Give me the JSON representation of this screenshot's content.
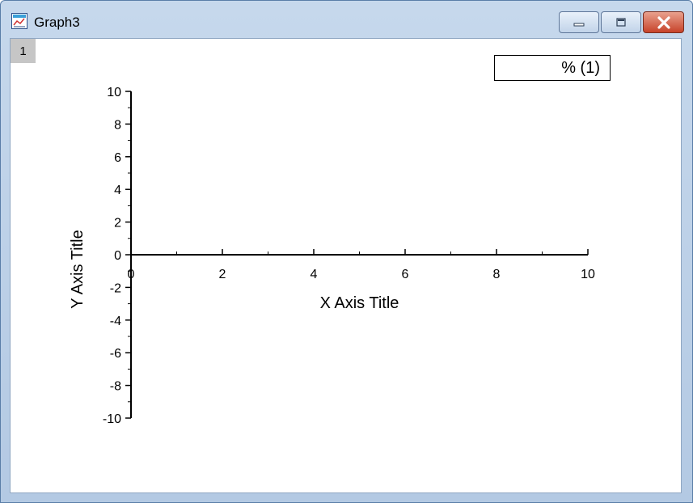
{
  "window": {
    "title": "Graph3"
  },
  "graph": {
    "layer_label": "1",
    "legend_text": "% (1)"
  },
  "chart_data": {
    "type": "line",
    "title": "",
    "xlabel": "X Axis Title",
    "ylabel": "Y Axis Title",
    "xlim": [
      0,
      10
    ],
    "ylim": [
      -10,
      10
    ],
    "x_ticks": [
      0,
      2,
      4,
      6,
      8,
      10
    ],
    "y_ticks": [
      -10,
      -8,
      -6,
      -4,
      -2,
      0,
      2,
      4,
      6,
      8,
      10
    ],
    "series": [],
    "grid": false,
    "legend_position": "top-right"
  }
}
